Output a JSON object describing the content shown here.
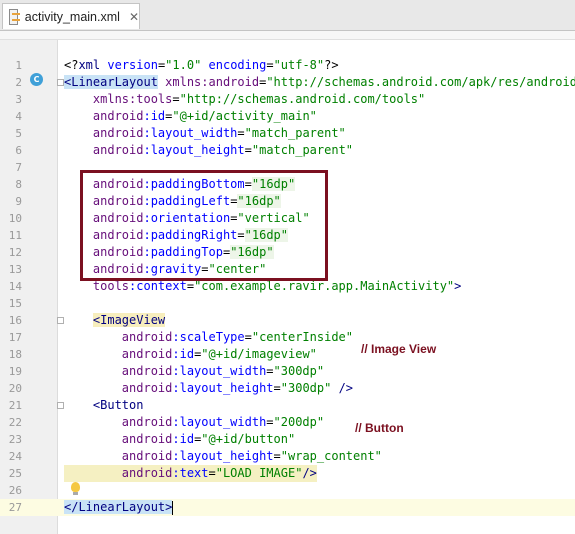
{
  "tab": {
    "filename": "activity_main.xml",
    "close": "✕"
  },
  "gutter_marker": "C",
  "lines": [
    {
      "n": "1",
      "parts": [
        {
          "c": "t-plain",
          "t": "<?"
        },
        {
          "c": "t-tag",
          "t": "xml"
        },
        {
          "c": "t-attr",
          "t": " version"
        },
        {
          "c": "t-plain",
          "t": "="
        },
        {
          "c": "t-val",
          "t": "\"1.0\""
        },
        {
          "c": "t-attr",
          "t": " encoding"
        },
        {
          "c": "t-plain",
          "t": "="
        },
        {
          "c": "t-val",
          "t": "\"utf-8\""
        },
        {
          "c": "t-plain",
          "t": "?>"
        }
      ]
    },
    {
      "n": "2",
      "parts": [
        {
          "c": "t-tagh",
          "t": "<LinearLayout"
        },
        {
          "c": "t-ns",
          "t": " xmlns:android"
        },
        {
          "c": "t-plain",
          "t": "="
        },
        {
          "c": "t-val",
          "t": "\"http://schemas.android.com/apk/res/android\""
        }
      ]
    },
    {
      "n": "3",
      "parts": [
        {
          "c": "t-ns",
          "t": "    xmlns:tools"
        },
        {
          "c": "t-plain",
          "t": "="
        },
        {
          "c": "t-val",
          "t": "\"http://schemas.android.com/tools\""
        }
      ]
    },
    {
      "n": "4",
      "parts": [
        {
          "c": "t-ns",
          "t": "    android"
        },
        {
          "c": "t-attr",
          "t": ":id"
        },
        {
          "c": "t-plain",
          "t": "="
        },
        {
          "c": "t-val",
          "t": "\"@+id/activity_main\""
        }
      ]
    },
    {
      "n": "5",
      "parts": [
        {
          "c": "t-ns",
          "t": "    android"
        },
        {
          "c": "t-attr",
          "t": ":layout_width"
        },
        {
          "c": "t-plain",
          "t": "="
        },
        {
          "c": "t-val",
          "t": "\"match_parent\""
        }
      ]
    },
    {
      "n": "6",
      "parts": [
        {
          "c": "t-ns",
          "t": "    android"
        },
        {
          "c": "t-attr",
          "t": ":layout_height"
        },
        {
          "c": "t-plain",
          "t": "="
        },
        {
          "c": "t-val",
          "t": "\"match_parent\""
        }
      ]
    },
    {
      "n": "7",
      "parts": []
    },
    {
      "n": "8",
      "parts": [
        {
          "c": "t-ns",
          "t": "    android"
        },
        {
          "c": "t-attr",
          "t": ":paddingBottom"
        },
        {
          "c": "t-plain",
          "t": "="
        },
        {
          "c": "t-valb",
          "t": "\"16dp\""
        }
      ]
    },
    {
      "n": "9",
      "parts": [
        {
          "c": "t-ns",
          "t": "    android"
        },
        {
          "c": "t-attr",
          "t": ":paddingLeft"
        },
        {
          "c": "t-plain",
          "t": "="
        },
        {
          "c": "t-valb",
          "t": "\"16dp\""
        }
      ]
    },
    {
      "n": "10",
      "parts": [
        {
          "c": "t-ns",
          "t": "    android"
        },
        {
          "c": "t-attr",
          "t": ":orientation"
        },
        {
          "c": "t-plain",
          "t": "="
        },
        {
          "c": "t-val",
          "t": "\"vertical\""
        }
      ]
    },
    {
      "n": "11",
      "parts": [
        {
          "c": "t-ns",
          "t": "    android"
        },
        {
          "c": "t-attr",
          "t": ":paddingRight"
        },
        {
          "c": "t-plain",
          "t": "="
        },
        {
          "c": "t-valb",
          "t": "\"16dp\""
        }
      ]
    },
    {
      "n": "12",
      "parts": [
        {
          "c": "t-ns",
          "t": "    android"
        },
        {
          "c": "t-attr",
          "t": ":paddingTop"
        },
        {
          "c": "t-plain",
          "t": "="
        },
        {
          "c": "t-valb",
          "t": "\"16dp\""
        }
      ]
    },
    {
      "n": "13",
      "parts": [
        {
          "c": "t-ns",
          "t": "    android"
        },
        {
          "c": "t-attr",
          "t": ":gravity"
        },
        {
          "c": "t-plain",
          "t": "="
        },
        {
          "c": "t-val",
          "t": "\"center\""
        }
      ]
    },
    {
      "n": "14",
      "parts": [
        {
          "c": "t-ns",
          "t": "    tools"
        },
        {
          "c": "t-attr",
          "t": ":context"
        },
        {
          "c": "t-plain",
          "t": "="
        },
        {
          "c": "t-val",
          "t": "\"com.example.ravir.app.MainActivity\""
        },
        {
          "c": "t-tag",
          "t": ">"
        }
      ]
    },
    {
      "n": "15",
      "parts": []
    },
    {
      "n": "16",
      "parts": [
        {
          "c": "t-plain",
          "t": "    "
        },
        {
          "c": "t-tagy",
          "t": "<ImageView"
        }
      ]
    },
    {
      "n": "17",
      "parts": [
        {
          "c": "t-ns",
          "t": "        android"
        },
        {
          "c": "t-attr",
          "t": ":scaleType"
        },
        {
          "c": "t-plain",
          "t": "="
        },
        {
          "c": "t-val",
          "t": "\"centerInside\""
        }
      ]
    },
    {
      "n": "18",
      "parts": [
        {
          "c": "t-ns",
          "t": "        android"
        },
        {
          "c": "t-attr",
          "t": ":id"
        },
        {
          "c": "t-plain",
          "t": "="
        },
        {
          "c": "t-val",
          "t": "\"@+id/imageview\""
        }
      ]
    },
    {
      "n": "19",
      "parts": [
        {
          "c": "t-ns",
          "t": "        android"
        },
        {
          "c": "t-attr",
          "t": ":layout_width"
        },
        {
          "c": "t-plain",
          "t": "="
        },
        {
          "c": "t-val",
          "t": "\"300dp\""
        }
      ]
    },
    {
      "n": "20",
      "parts": [
        {
          "c": "t-ns",
          "t": "        android"
        },
        {
          "c": "t-attr",
          "t": ":layout_height"
        },
        {
          "c": "t-plain",
          "t": "="
        },
        {
          "c": "t-val",
          "t": "\"300dp\""
        },
        {
          "c": "t-tag",
          "t": " />"
        }
      ]
    },
    {
      "n": "21",
      "parts": [
        {
          "c": "t-tag",
          "t": "    <Button"
        }
      ]
    },
    {
      "n": "22",
      "parts": [
        {
          "c": "t-ns",
          "t": "        android"
        },
        {
          "c": "t-attr",
          "t": ":layout_width"
        },
        {
          "c": "t-plain",
          "t": "="
        },
        {
          "c": "t-val",
          "t": "\"200dp\""
        }
      ]
    },
    {
      "n": "23",
      "parts": [
        {
          "c": "t-ns",
          "t": "        android"
        },
        {
          "c": "t-attr",
          "t": ":id"
        },
        {
          "c": "t-plain",
          "t": "="
        },
        {
          "c": "t-val",
          "t": "\"@+id/button\""
        }
      ]
    },
    {
      "n": "24",
      "parts": [
        {
          "c": "t-ns",
          "t": "        android"
        },
        {
          "c": "t-attr",
          "t": ":layout_height"
        },
        {
          "c": "t-plain",
          "t": "="
        },
        {
          "c": "t-val",
          "t": "\"wrap_content\""
        }
      ]
    },
    {
      "n": "25",
      "hl": true,
      "parts": [
        {
          "c": "t-ns",
          "t": "        android"
        },
        {
          "c": "t-attr",
          "t": ":text"
        },
        {
          "c": "t-plain",
          "t": "="
        },
        {
          "c": "t-val",
          "t": "\"LOAD IMAGE\""
        },
        {
          "c": "t-tag",
          "t": "/>"
        }
      ]
    },
    {
      "n": "26",
      "parts": []
    },
    {
      "n": "27",
      "current": true,
      "parts": [
        {
          "c": "t-tagh",
          "t": "</LinearLayout>"
        }
      ]
    }
  ],
  "annotations": {
    "image_view": "// Image View",
    "button": "// Button"
  }
}
